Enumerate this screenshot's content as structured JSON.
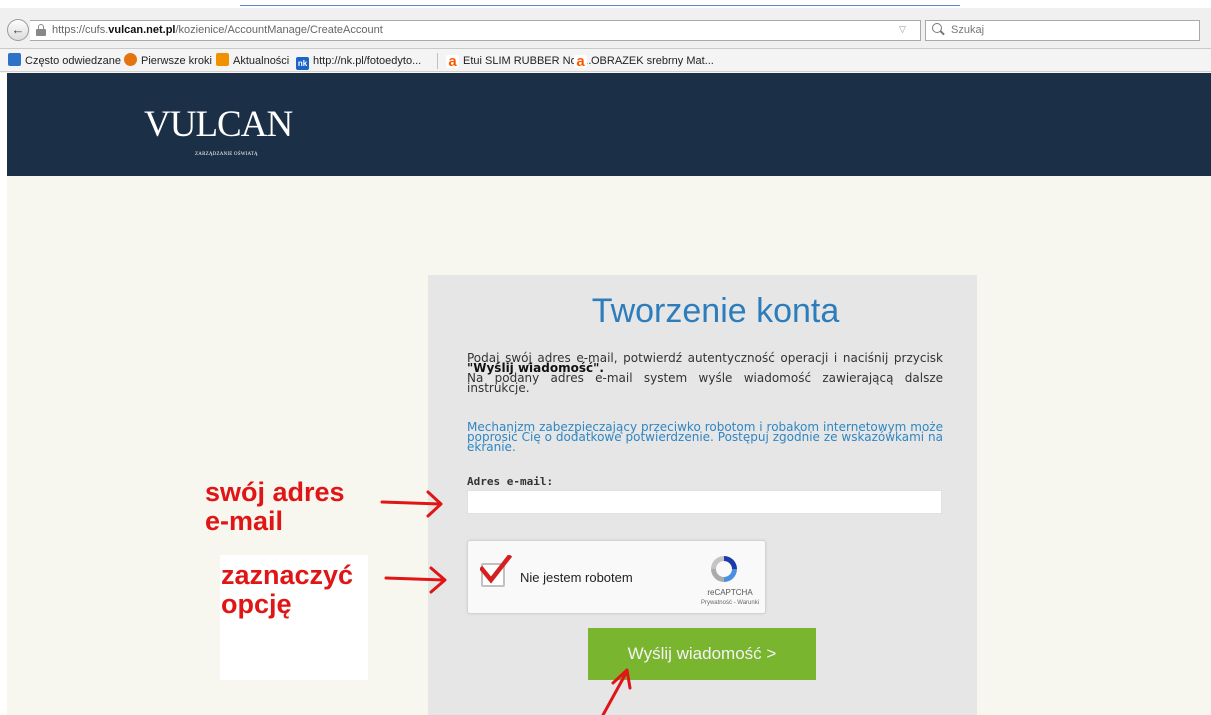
{
  "browser": {
    "url_prefix": "https://cufs.",
    "url_domain": "vulcan.net.pl",
    "url_path": "/kozienice/AccountManage/CreateAccount",
    "dropdown_glyph": "▽",
    "reload_glyph": "C",
    "search_placeholder": "Szukaj",
    "back_glyph": "←",
    "bookmarks": [
      {
        "label": "Często odwiedzane",
        "icon": "ie-icon"
      },
      {
        "label": "Pierwsze kroki",
        "icon": "firefox-icon"
      },
      {
        "label": "Aktualności",
        "icon": "rss-icon"
      },
      {
        "label": "http://nk.pl/fotoedyto...",
        "icon": "nk-icon"
      },
      {
        "label": "Etui SLIM RUBBER Nok...",
        "icon": "allegro-icon"
      },
      {
        "label": "OBRAZEK srebrny Mat...",
        "icon": "allegro-icon"
      }
    ],
    "nk_icon_text": "nk",
    "a_icon_text": "a"
  },
  "header": {
    "logo": "VULCAN",
    "logo_sub": "ZARZĄDZANIE OŚWIATĄ",
    "bg_color": "#1b3047"
  },
  "form": {
    "title": "Tworzenie konta",
    "intro_1": "Podaj swój adres e-mail, potwierdź autentyczność operacji i naciśnij przycisk ",
    "intro_bold": "\"Wyślij wiadomość\".",
    "intro_2": "Na podany adres e-mail system wyśle wiadomość zawierającą dalsze instrukcje.",
    "captcha_info": "Mechanizm zabezpieczający przeciwko robotom i robakom internetowym może poprosić Cię o dodatkowe potwierdzenie. Postępuj zgodnie ze wskazówkami na ekranie.",
    "email_label": "Adres e-mail:",
    "email_value": "",
    "captcha_label": "Nie jestem robotem",
    "captcha_brand": "reCAPTCHA",
    "captcha_terms": "Prywatność - Warunki",
    "captcha_checked": true,
    "submit_label": "Wyślij wiadomość >",
    "title_color": "#2d7dbc",
    "button_color": "#7ab530"
  },
  "annotations": {
    "email_note_line1": "swój adres",
    "email_note_line2": "e-mail",
    "captcha_note_line1": "zaznaczyć",
    "captcha_note_line2": "opcję",
    "color": "#e01616"
  }
}
